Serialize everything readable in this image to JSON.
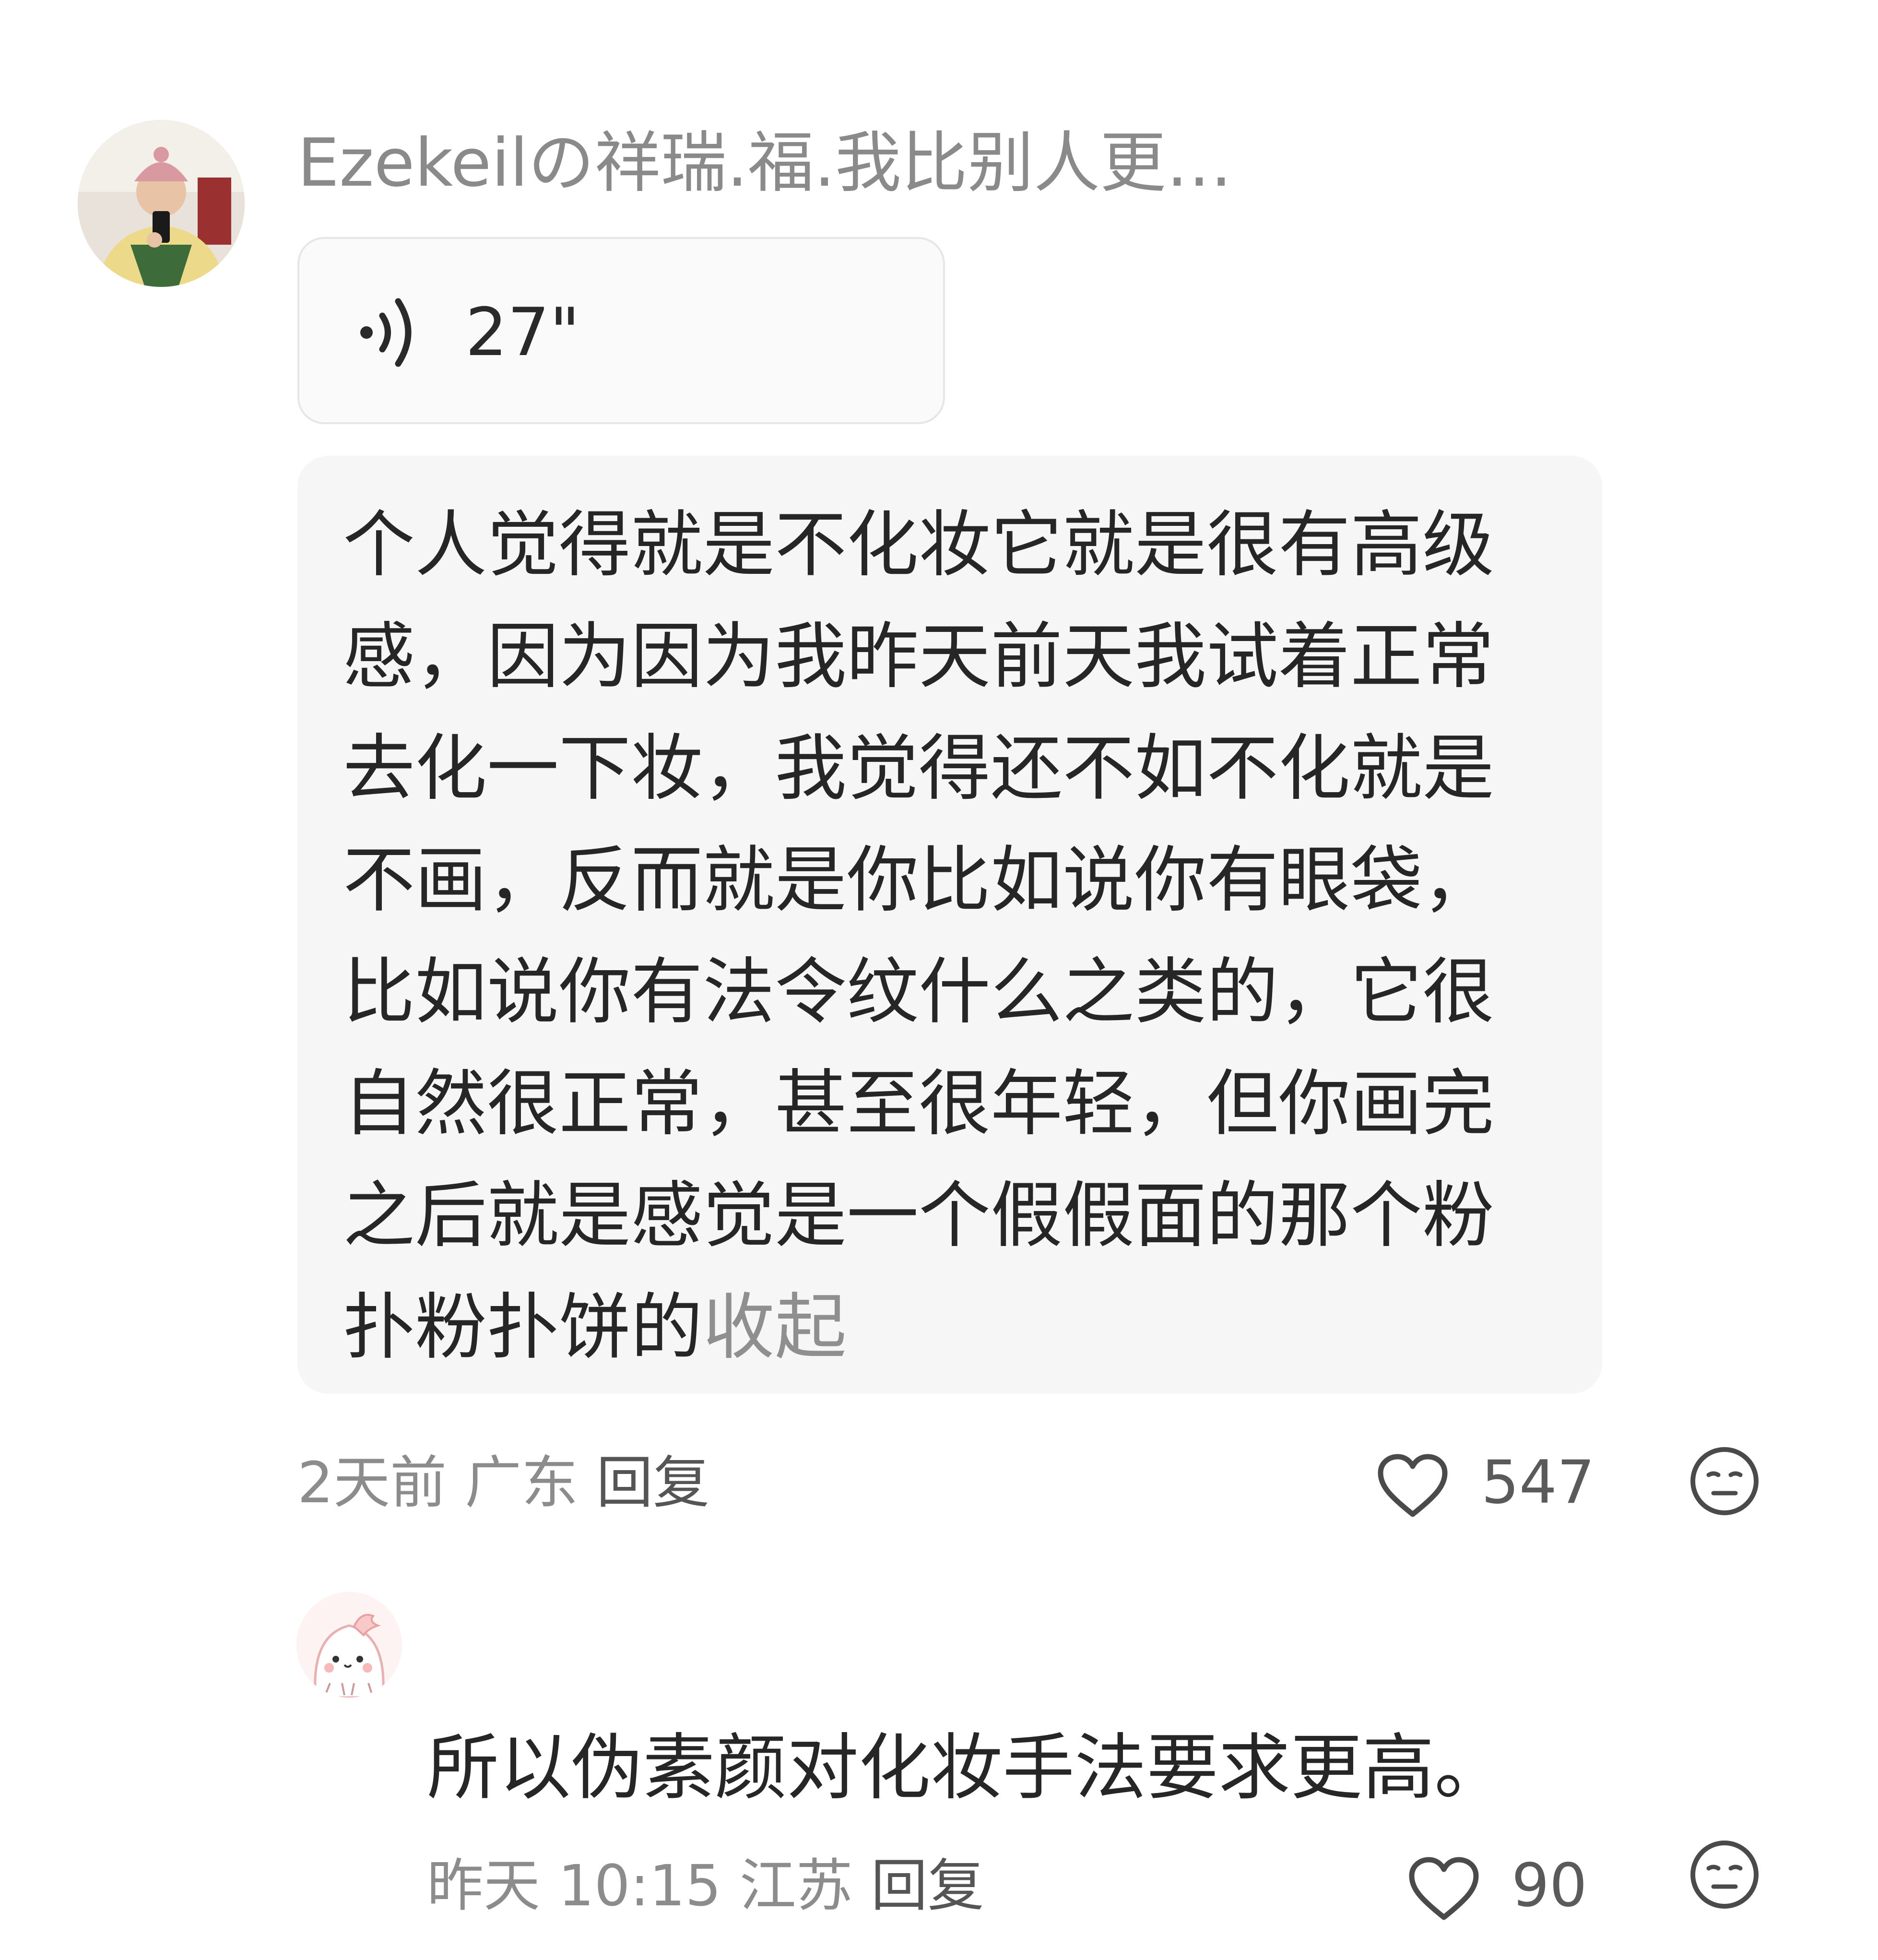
{
  "comments": [
    {
      "username": "Ezekeilの祥瑞.福.我比别人更…",
      "voice_duration": "27\"",
      "text": "个人觉得就是不化妆它就是很有高级感，因为因为我昨天前天我试着正常去化一下妆，我觉得还不如不化就是不画，反而就是你比如说你有眼袋，比如说你有法令纹什么之类的，它很自然很正常，甚至很年轻，但你画完之后就是感觉是一个假假面的那个粉扑粉扑饼的",
      "collapse_label": "收起",
      "time": "2天前",
      "location": "广东",
      "reply_label": "回复",
      "likes": "547"
    },
    {
      "text": "所以伪素颜对化妆手法要求更高。",
      "time": "昨天 10:15",
      "location": "江苏",
      "reply_label": "回复",
      "likes": "90"
    }
  ],
  "icons": {
    "voice": "voice-wave-icon",
    "like": "heart-outline-icon",
    "reaction": "neutral-face-emoji-icon"
  },
  "colors": {
    "secondary_text": "#8c8c8c",
    "bubble_bg": "#f6f6f6",
    "primary_text": "#262626"
  }
}
